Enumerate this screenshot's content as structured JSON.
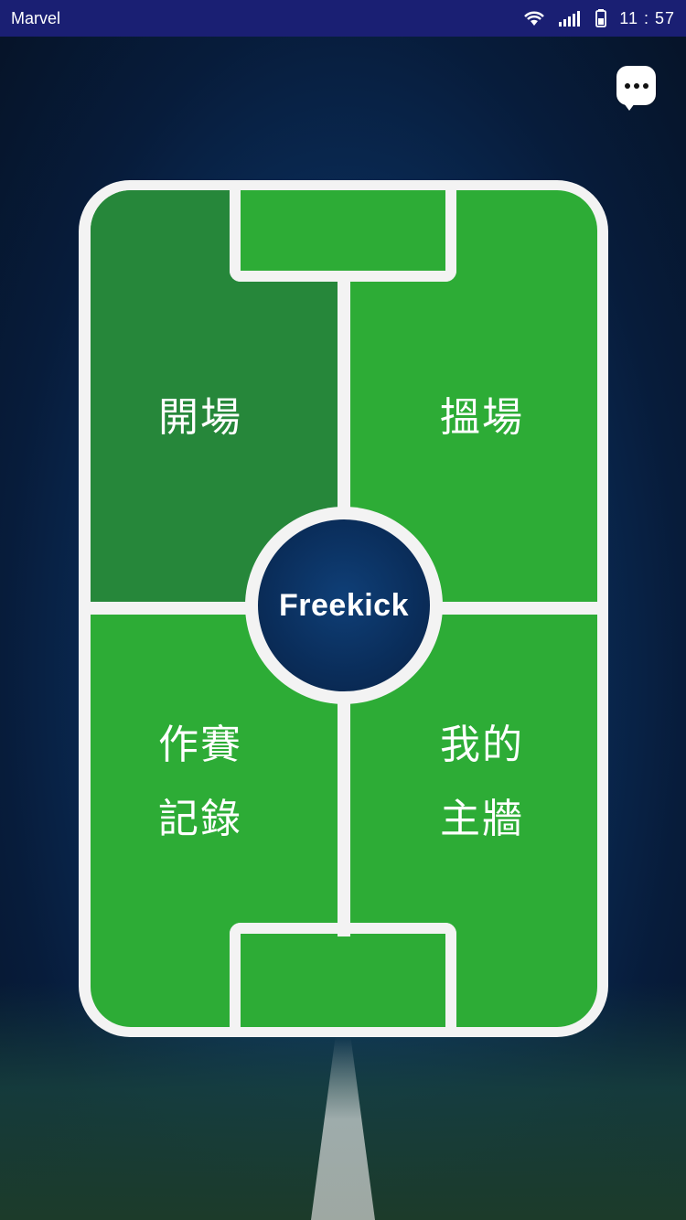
{
  "status_bar": {
    "carrier": "Marvel",
    "time": "11 : 57"
  },
  "message_button": {
    "icon": "chat-bubble-more-icon",
    "background": "#FFFFFF"
  },
  "center": {
    "title": "Freekick"
  },
  "quadrants": [
    {
      "label_line1": "開場",
      "label_line2": "",
      "color": "#26873a"
    },
    {
      "label_line1": "搵場",
      "label_line2": "",
      "color": "#2dac36"
    },
    {
      "label_line1": "作賽",
      "label_line2": "記錄",
      "color": "#2dac36"
    },
    {
      "label_line1": "我的",
      "label_line2": "主牆",
      "color": "#2dac36"
    }
  ],
  "colors": {
    "status_bar": "#1a1f73",
    "field_line": "#f3f3f3",
    "center_fill": "#0a2d5a"
  }
}
